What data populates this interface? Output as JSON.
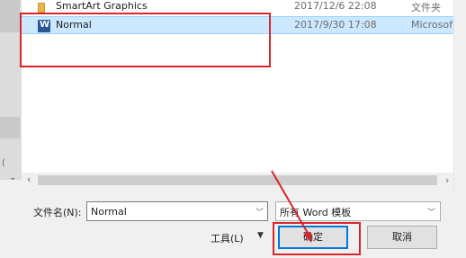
{
  "file_list": {
    "rows": [
      {
        "name": "SmartArt Graphics",
        "date": "2017/12/6 22:08",
        "type": "文件夹",
        "icon": "folder-icon",
        "selected": false
      },
      {
        "name": "Normal",
        "date": "2017/9/30 17:08",
        "type": "Microsof",
        "icon": "word-document-icon",
        "selected": true
      }
    ]
  },
  "bottom_bar": {
    "filename_label": "文件名(N):",
    "filename_value": "Normal",
    "filetype_value": "所有 Word 模板",
    "tools_label": "工具(L)",
    "ok_label": "确定",
    "cancel_label": "取消"
  },
  "colors": {
    "annotation": "#d9262c",
    "selection": "#cce8ff",
    "accent": "#0078d7"
  }
}
